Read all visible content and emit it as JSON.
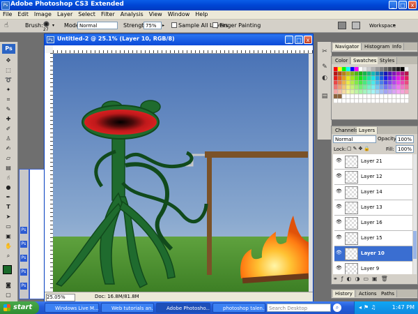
{
  "window": {
    "title": "Adobe Photoshop CS3 Extended",
    "controls": [
      "_",
      "□",
      "x"
    ]
  },
  "menu": [
    "File",
    "Edit",
    "Image",
    "Layer",
    "Select",
    "Filter",
    "Analysis",
    "View",
    "Window",
    "Help"
  ],
  "options": {
    "brush_label": "Brush:",
    "brush_size": "27",
    "mode_label": "Mode:",
    "mode_value": "Normal",
    "strength_label": "Strength:",
    "strength_value": "75%",
    "sample_all_layers": "Sample All Layers",
    "finger_painting": "Finger Painting",
    "workspace": "Workspace"
  },
  "toolbox": {
    "logo": "Ps"
  },
  "document": {
    "title": "Untitled-2 @ 25.1% (Layer 10, RGB/8)",
    "zoom": "25.05%",
    "doc_info": "Doc: 16.8M/81.8M"
  },
  "panels": {
    "navigator_tabs": [
      "Navigator",
      "Histogram",
      "Info"
    ],
    "color_tabs": [
      "Color",
      "Swatches",
      "Styles"
    ],
    "layer_tabs": [
      "Channels",
      "Layers"
    ],
    "blend_mode": "Normal",
    "opacity_label": "Opacity:",
    "opacity_value": "100%",
    "lock_label": "Lock:",
    "fill_label": "Fill:",
    "fill_value": "100%",
    "layers": [
      {
        "name": "Layer 21",
        "selected": false
      },
      {
        "name": "Layer 12",
        "selected": false
      },
      {
        "name": "Layer 14",
        "selected": false
      },
      {
        "name": "Layer 13",
        "selected": false
      },
      {
        "name": "Layer 16",
        "selected": false
      },
      {
        "name": "Layer 15",
        "selected": false
      },
      {
        "name": "Layer 10",
        "selected": true
      },
      {
        "name": "Layer 9",
        "selected": false
      }
    ],
    "history_tabs": [
      "History",
      "Actions",
      "Paths"
    ]
  },
  "taskbar": {
    "start": "start",
    "items": [
      {
        "label": "Windows Live M...",
        "active": false
      },
      {
        "label": "Web tutorials an...",
        "active": false
      },
      {
        "label": "Adobe Photosho...",
        "active": true
      },
      {
        "label": "photoshop talen...",
        "active": false
      }
    ],
    "search_placeholder": "Search Desktop",
    "clock": "1:47 PM"
  },
  "colors": {
    "accent": "#0046d5",
    "selection": "#3a6ed1",
    "sky": "#4f79b8",
    "grass": "#3f8a2a",
    "creature": "#1f6b2e"
  }
}
